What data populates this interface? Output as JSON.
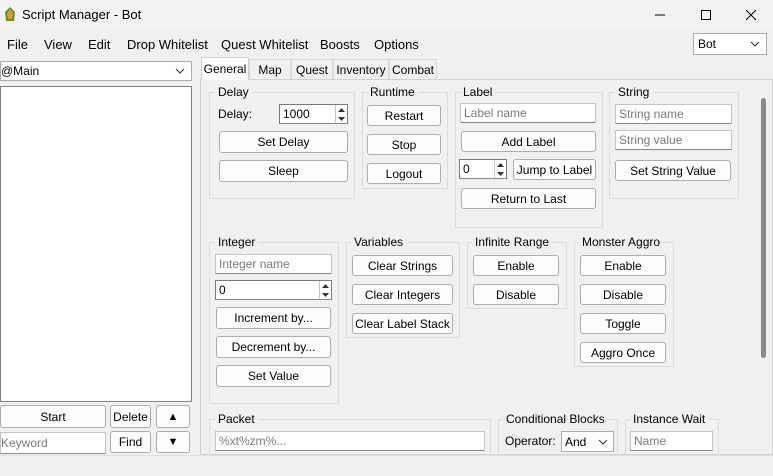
{
  "window": {
    "title": "Script Manager - Bot"
  },
  "menu": {
    "items": [
      "File",
      "View",
      "Edit",
      "Drop Whitelist",
      "Quest Whitelist",
      "Boosts",
      "Options"
    ]
  },
  "profile_select": {
    "value": "Bot"
  },
  "left": {
    "script_select": "@Main",
    "start_label": "Start",
    "delete_label": "Delete",
    "up_label": "▲",
    "down_label": "▼",
    "keyword_placeholder": "Keyword",
    "find_label": "Find"
  },
  "tabs": [
    "General",
    "Map",
    "Quest",
    "Inventory",
    "Combat"
  ],
  "delay": {
    "title": "Delay",
    "label": "Delay:",
    "value": "1000",
    "set_delay": "Set Delay",
    "sleep": "Sleep"
  },
  "runtime": {
    "title": "Runtime",
    "restart": "Restart",
    "stop": "Stop",
    "logout": "Logout"
  },
  "label_group": {
    "title": "Label",
    "name_placeholder": "Label name",
    "add": "Add Label",
    "index_value": "0",
    "jump": "Jump to Label",
    "return": "Return to Last"
  },
  "string_group": {
    "title": "String",
    "name_placeholder": "String name",
    "value_placeholder": "String value",
    "set": "Set String Value"
  },
  "integer_group": {
    "title": "Integer",
    "name_placeholder": "Integer name",
    "value": "0",
    "increment": "Increment by...",
    "decrement": "Decrement by...",
    "set": "Set Value"
  },
  "variables": {
    "title": "Variables",
    "clear_strings": "Clear Strings",
    "clear_integers": "Clear Integers",
    "clear_label_stack": "Clear Label Stack"
  },
  "infinite_range": {
    "title": "Infinite Range",
    "enable": "Enable",
    "disable": "Disable"
  },
  "monster_aggro": {
    "title": "Monster Aggro",
    "enable": "Enable",
    "disable": "Disable",
    "toggle": "Toggle",
    "aggro_once": "Aggro Once"
  },
  "packet": {
    "title": "Packet",
    "placeholder": "%xt%zm%..."
  },
  "conditional": {
    "title": "Conditional Blocks",
    "operator_label": "Operator:",
    "operator_value": "And"
  },
  "instance_wait": {
    "title": "Instance Wait",
    "name_placeholder": "Name"
  }
}
